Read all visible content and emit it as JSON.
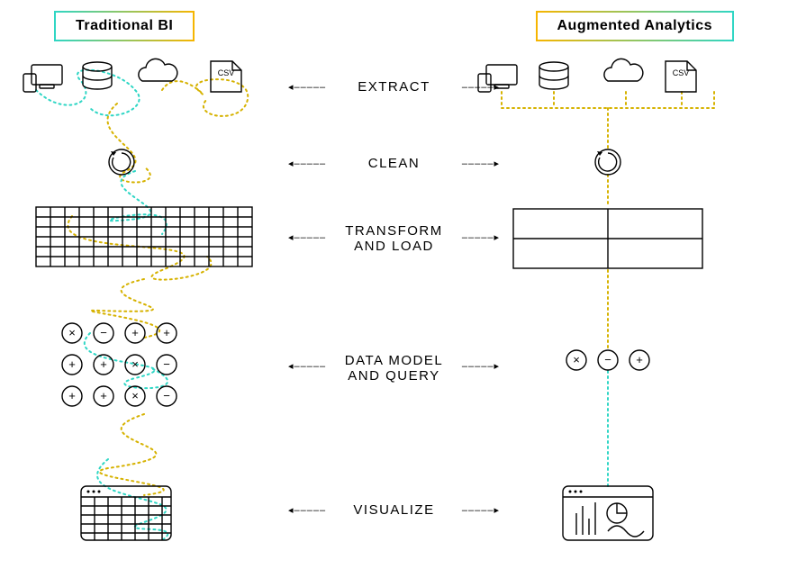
{
  "titles": {
    "left": "Traditional BI",
    "right": "Augmented Analytics"
  },
  "stages": {
    "s1": "EXTRACT",
    "s2": "CLEAN",
    "s3": "TRANSFORM\nAND LOAD",
    "s4": "DATA MODEL\nAND QUERY",
    "s5": "VISUALIZE"
  },
  "icons": {
    "csv_label": "CSV"
  },
  "colors": {
    "accent_yellow": "#d6b200",
    "accent_teal": "#2fd6c5"
  }
}
